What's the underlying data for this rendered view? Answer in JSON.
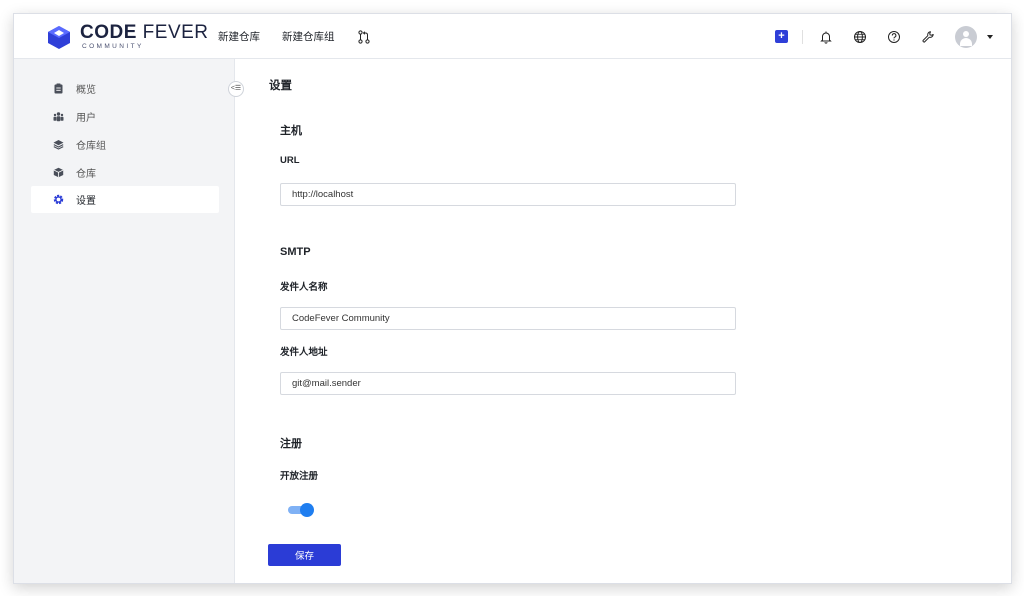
{
  "app": {
    "logo_bold": "CODE",
    "logo_light": " FEVER",
    "logo_sub": "COMMUNITY"
  },
  "topnav": {
    "new_repo": "新建仓库",
    "new_repo_group": "新建仓库组",
    "pull_request_icon": "git-pull-request-icon"
  },
  "topright": {
    "add_icon": "plus-square-icon",
    "icons": [
      "bell-icon",
      "globe-icon",
      "help-icon",
      "wrench-icon",
      "avatar"
    ]
  },
  "sidebar": {
    "items": [
      {
        "label": "概览",
        "icon": "clipboard-icon",
        "active": false
      },
      {
        "label": "用户",
        "icon": "users-icon",
        "active": false
      },
      {
        "label": "仓库组",
        "icon": "layers-icon",
        "active": false
      },
      {
        "label": "仓库",
        "icon": "box-icon",
        "active": false
      },
      {
        "label": "设置",
        "icon": "gear-icon",
        "active": true
      }
    ],
    "collapse_label": "<☰"
  },
  "main": {
    "page_title": "设置",
    "host": {
      "title": "主机",
      "url_label": "URL",
      "url_value": "http://localhost"
    },
    "smtp": {
      "title": "SMTP",
      "sender_name_label": "发件人名称",
      "sender_name_value": "CodeFever Community",
      "sender_addr_label": "发件人地址",
      "sender_addr_value": "git@mail.sender"
    },
    "register": {
      "title": "注册",
      "open_label": "开放注册",
      "open_enabled": true
    },
    "save_label": "保存"
  },
  "colors": {
    "primary": "#2b3cd6",
    "toggle_on": "#1f7ef0",
    "sidebar_bg": "#f3f4f6"
  }
}
